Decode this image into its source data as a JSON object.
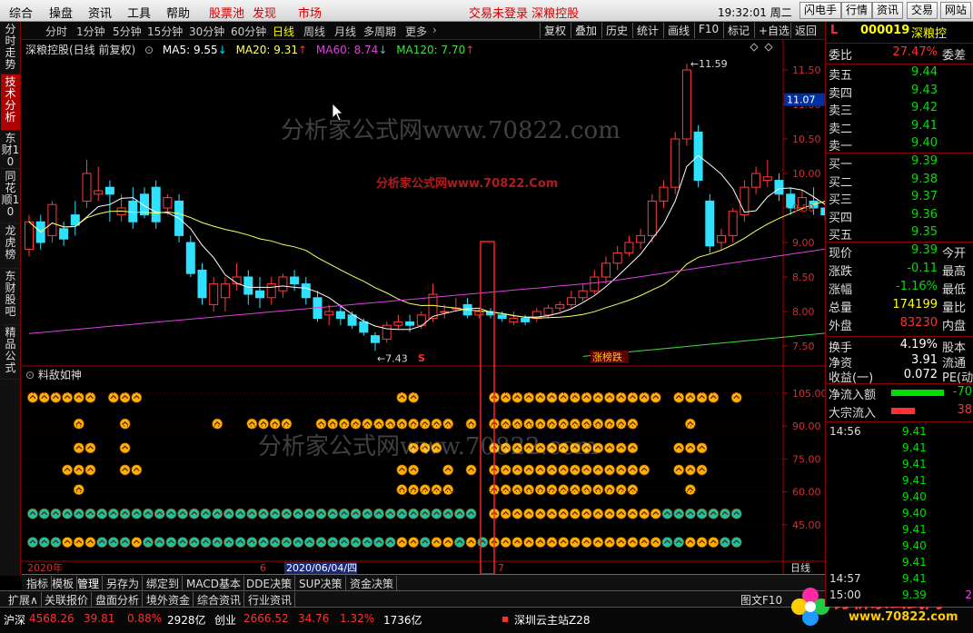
{
  "top_menu": [
    "综合",
    "操盘",
    "资讯",
    "工具",
    "帮助",
    "股票池",
    "发现",
    "市场"
  ],
  "top_center": "交易未登录  深粮控股",
  "top_time": "19:32:01 周二",
  "top_buttons": [
    "闪电手",
    "行情",
    "资讯",
    "交易",
    "网站"
  ],
  "left_tabs": [
    "分时走势",
    "技术分析",
    "东财10",
    "同花顺10",
    "龙虎榜",
    "东财股吧",
    "精品公式"
  ],
  "toolbar_items": [
    "分时",
    "1分钟",
    "5分钟",
    "15分钟",
    "30分钟",
    "60分钟",
    "日线",
    "周线",
    "月线",
    "多周期",
    "更多"
  ],
  "toolbar_active": "日线",
  "toolbar_right": [
    "复权",
    "叠加",
    "历史",
    "统计",
    "画线",
    "F10",
    "标记",
    "+自选",
    "返回"
  ],
  "chart_title": "深粮控股(日线 前复权)",
  "ma": [
    {
      "label": "MA5: 9.55",
      "color": "#ffffff"
    },
    {
      "label": "MA20: 9.31",
      "color": "#ffff60"
    },
    {
      "label": "MA60: 8.74",
      "color": "#e040e0"
    },
    {
      "label": "MA120: 7.70",
      "color": "#40e040"
    }
  ],
  "watermark": "分析家公式网www.70822.com",
  "watermark_red": "分析家公式网www.70822.Com",
  "price_labels": {
    "high": "11.59",
    "low": "7.43",
    "current": "11.07",
    "event_s": "S",
    "event": "涨榜跌"
  },
  "indicator_name": "料敌如神",
  "date_labels": {
    "year": "2020年",
    "month6": "6",
    "date": "2020/06/04/四",
    "month7": "7",
    "period": "日线"
  },
  "bottom_tabs": [
    "指标",
    "模板",
    "管理",
    "另存为",
    "绑定到",
    "MACD基本",
    "DDE决策",
    "SUP决策",
    "资金决策"
  ],
  "bottom_tabs2": [
    "扩展∧",
    "关联报价",
    "盘面分析",
    "境外资金",
    "综合资讯",
    "行业资讯"
  ],
  "bottom_right": "图文F10",
  "status": {
    "sh_label": "沪深",
    "sh_index": "4568.26",
    "sh_chg": "39.81",
    "sh_pct": "0.88%",
    "sh_amt": "2928亿",
    "cy_label": "创业",
    "cy_index": "2666.52",
    "cy_chg": "34.76",
    "cy_pct": "1.32%",
    "cy_amt": "1736亿",
    "server": "深圳云主站Z28"
  },
  "brand": "分析家公式网",
  "brand_url": "www.70822.com",
  "quote": {
    "flag": "L",
    "code": "000019",
    "name": "深粮控",
    "weibi_label": "委比",
    "weibi": "27.47%",
    "weicha_label": "委差",
    "asks": [
      {
        "label": "卖五",
        "price": "9.44"
      },
      {
        "label": "卖四",
        "price": "9.43"
      },
      {
        "label": "卖三",
        "price": "9.42"
      },
      {
        "label": "卖二",
        "price": "9.41"
      },
      {
        "label": "卖一",
        "price": "9.40"
      }
    ],
    "bids": [
      {
        "label": "买一",
        "price": "9.39"
      },
      {
        "label": "买二",
        "price": "9.38"
      },
      {
        "label": "买三",
        "price": "9.37"
      },
      {
        "label": "买四",
        "price": "9.36"
      },
      {
        "label": "买五",
        "price": "9.35"
      }
    ],
    "stats": [
      {
        "label": "现价",
        "value": "9.39",
        "color": "#00e000",
        "label2": "今开"
      },
      {
        "label": "涨跌",
        "value": "-0.11",
        "color": "#00e000",
        "label2": "最高"
      },
      {
        "label": "涨幅",
        "value": "-1.16%",
        "color": "#00e000",
        "label2": "最低"
      },
      {
        "label": "总量",
        "value": "174199",
        "color": "#ffff00",
        "label2": "量比"
      },
      {
        "label": "外盘",
        "value": "83230",
        "color": "#ff3030",
        "label2": "内盘"
      }
    ],
    "stats2": [
      {
        "label": "换手",
        "value": "4.19%",
        "color": "#ffffff",
        "label2": "股本"
      },
      {
        "label": "净资",
        "value": "3.91",
        "color": "#ffffff",
        "label2": "流通"
      },
      {
        "label": "收益(一)",
        "value": "0.072",
        "color": "#ffffff",
        "label2": "PE(动"
      }
    ],
    "flow": [
      {
        "label": "净流入额",
        "value": "-70",
        "color": "#00e000"
      },
      {
        "label": "大宗流入",
        "value": "38",
        "color": "#ff3030"
      }
    ],
    "ticks": [
      {
        "time": "14:56",
        "price": "9.41",
        "color": "#00e000"
      },
      {
        "time": "",
        "price": "9.41",
        "color": "#00e000"
      },
      {
        "time": "",
        "price": "9.41",
        "color": "#00e000"
      },
      {
        "time": "",
        "price": "9.41",
        "color": "#00e000"
      },
      {
        "time": "",
        "price": "9.40",
        "color": "#00e000"
      },
      {
        "time": "",
        "price": "9.40",
        "color": "#00e000"
      },
      {
        "time": "",
        "price": "9.41",
        "color": "#00e000"
      },
      {
        "time": "",
        "price": "9.40",
        "color": "#00e000"
      },
      {
        "time": "",
        "price": "9.41",
        "color": "#00e000"
      },
      {
        "time": "14:57",
        "price": "9.41",
        "color": "#00e000"
      },
      {
        "time": "15:00",
        "price": "9.39",
        "color": "#00e000",
        "extra": "2"
      }
    ]
  },
  "chart_data": [
    {
      "type": "candlestick",
      "title": "深粮控股(日线 前复权)",
      "ylim": [
        7.25,
        11.75
      ],
      "yticks": [
        7.5,
        8.0,
        8.5,
        9.0,
        9.5,
        10.0,
        10.5,
        11.0,
        11.5
      ],
      "candles": [
        [
          8.9,
          9.3,
          8.8,
          9.4
        ],
        [
          9.3,
          9.0,
          8.9,
          9.4
        ],
        [
          9.1,
          9.55,
          9.0,
          9.6
        ],
        [
          9.2,
          9.05,
          8.95,
          9.3
        ],
        [
          9.4,
          9.25,
          9.1,
          9.6
        ],
        [
          9.6,
          10.0,
          9.5,
          10.2
        ],
        [
          9.7,
          9.75,
          9.6,
          10.1
        ],
        [
          9.8,
          9.7,
          9.3,
          9.9
        ],
        [
          9.4,
          9.5,
          9.3,
          9.7
        ],
        [
          9.6,
          9.3,
          9.2,
          9.8
        ],
        [
          9.7,
          9.4,
          9.35,
          9.8
        ],
        [
          9.8,
          9.3,
          9.2,
          9.9
        ],
        [
          9.5,
          9.65,
          9.4,
          9.7
        ],
        [
          9.6,
          9.1,
          9.0,
          9.7
        ],
        [
          9.0,
          8.55,
          8.5,
          9.1
        ],
        [
          8.6,
          8.2,
          8.1,
          8.7
        ],
        [
          8.1,
          8.4,
          8.0,
          8.5
        ],
        [
          8.2,
          8.4,
          8.0,
          8.5
        ],
        [
          8.4,
          8.5,
          8.3,
          8.7
        ],
        [
          8.5,
          8.25,
          8.1,
          8.6
        ],
        [
          8.3,
          8.2,
          8.05,
          8.5
        ],
        [
          8.2,
          8.4,
          8.1,
          8.5
        ],
        [
          8.3,
          8.5,
          8.2,
          8.55
        ],
        [
          8.5,
          8.4,
          8.3,
          8.6
        ],
        [
          8.4,
          8.2,
          8.1,
          8.5
        ],
        [
          8.2,
          7.9,
          7.85,
          8.3
        ],
        [
          7.95,
          8.0,
          7.8,
          8.1
        ],
        [
          8.0,
          7.9,
          7.8,
          8.1
        ],
        [
          7.95,
          7.8,
          7.75,
          8.0
        ],
        [
          7.85,
          7.7,
          7.65,
          7.9
        ],
        [
          7.65,
          7.55,
          7.43,
          7.7
        ],
        [
          7.6,
          7.8,
          7.55,
          7.85
        ],
        [
          7.8,
          7.85,
          7.75,
          7.95
        ],
        [
          7.85,
          7.8,
          7.7,
          7.95
        ],
        [
          7.8,
          7.95,
          7.75,
          8.0
        ],
        [
          7.9,
          8.25,
          7.85,
          8.4
        ],
        [
          8.0,
          8.0,
          7.9,
          8.1
        ],
        [
          8.05,
          8.05,
          8.0,
          8.2
        ],
        [
          8.1,
          7.95,
          7.9,
          8.2
        ],
        [
          7.95,
          8.0,
          7.9,
          8.05
        ],
        [
          8.0,
          7.95,
          7.9,
          8.05
        ],
        [
          7.95,
          7.9,
          7.85,
          8.0
        ],
        [
          7.85,
          7.9,
          7.8,
          8.0
        ],
        [
          7.9,
          7.85,
          7.8,
          7.95
        ],
        [
          7.9,
          8.0,
          7.85,
          8.05
        ],
        [
          7.95,
          8.05,
          7.9,
          8.1
        ],
        [
          8.05,
          8.1,
          8.0,
          8.15
        ],
        [
          8.1,
          8.2,
          8.05,
          8.3
        ],
        [
          8.2,
          8.3,
          8.15,
          8.4
        ],
        [
          8.3,
          8.5,
          8.25,
          8.6
        ],
        [
          8.5,
          8.7,
          8.4,
          8.8
        ],
        [
          8.7,
          8.85,
          8.6,
          8.95
        ],
        [
          8.85,
          9.0,
          8.8,
          9.1
        ],
        [
          9.0,
          9.1,
          8.9,
          9.2
        ],
        [
          9.1,
          9.6,
          9.0,
          9.7
        ],
        [
          9.6,
          9.8,
          9.5,
          9.9
        ],
        [
          9.8,
          10.5,
          9.7,
          10.6
        ],
        [
          10.5,
          11.5,
          10.4,
          11.59
        ],
        [
          10.6,
          9.9,
          9.8,
          10.7
        ],
        [
          9.6,
          8.95,
          8.85,
          9.7
        ],
        [
          9.0,
          9.1,
          8.9,
          9.2
        ],
        [
          9.1,
          9.45,
          9.0,
          9.5
        ],
        [
          9.4,
          9.8,
          9.3,
          9.9
        ],
        [
          9.8,
          10.0,
          9.7,
          10.1
        ],
        [
          9.9,
          9.95,
          9.8,
          10.2
        ],
        [
          9.9,
          9.7,
          9.6,
          10.0
        ],
        [
          9.7,
          9.5,
          9.4,
          9.8
        ],
        [
          9.5,
          9.65,
          9.45,
          9.75
        ],
        [
          9.6,
          9.5,
          9.4,
          9.8
        ],
        [
          9.5,
          9.4,
          9.3,
          9.55
        ]
      ]
    },
    {
      "type": "scatter",
      "title": "料敌如神",
      "ylim": [
        30,
        112
      ],
      "yticks": [
        45.0,
        60.0,
        75.0,
        90.0,
        105.0
      ]
    }
  ]
}
